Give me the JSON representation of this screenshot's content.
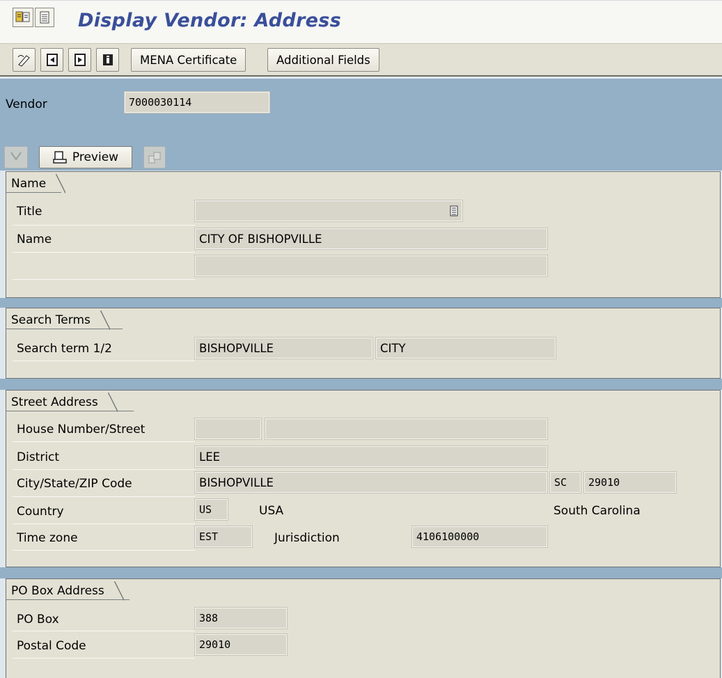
{
  "window": {
    "title": "Display Vendor: Address",
    "icons": [
      "command-icon",
      "menu-icon"
    ]
  },
  "toolbar": {
    "buttons": [
      {
        "icon": "edit-pen-icon"
      },
      {
        "icon": "previous-page-icon"
      },
      {
        "icon": "next-page-icon"
      },
      {
        "icon": "info-icon"
      }
    ],
    "mena_label": "MENA Certificate",
    "additional_label": "Additional Fields"
  },
  "header": {
    "vendor_label": "Vendor",
    "vendor_value": "7000030114"
  },
  "address_toolbar": {
    "preview_label": "Preview"
  },
  "name_group": {
    "title": "Name",
    "title_label": "Title",
    "title_value": "",
    "name_label": "Name",
    "name_value": "CITY OF BISHOPVILLE",
    "name2_value": ""
  },
  "search_group": {
    "title": "Search Terms",
    "label": "Search term 1/2",
    "term1": "BISHOPVILLE",
    "term2": "CITY"
  },
  "street_group": {
    "title": "Street Address",
    "house_label": "House Number/Street",
    "house_number": "",
    "street": "",
    "district_label": "District",
    "district_value": "LEE",
    "city_label": "City/State/ZIP Code",
    "city_value": "BISHOPVILLE",
    "state_value": "SC",
    "zip_value": "29010",
    "country_label": "Country",
    "country_code": "US",
    "country_name": "USA",
    "region_name": "South Carolina",
    "timezone_label": "Time zone",
    "timezone_value": "EST",
    "jurisdiction_label": "Jurisdiction",
    "jurisdiction_value": "4106100000"
  },
  "pobox_group": {
    "title": "PO Box Address",
    "pobox_label": "PO Box",
    "pobox_value": "388",
    "postal_label": "Postal Code",
    "postal_value": "29010"
  },
  "colors": {
    "band": "#94b0c6",
    "group_bg": "#e3e1d4",
    "title": "#3a4f9a",
    "field_bg": "#d8d6ca"
  }
}
